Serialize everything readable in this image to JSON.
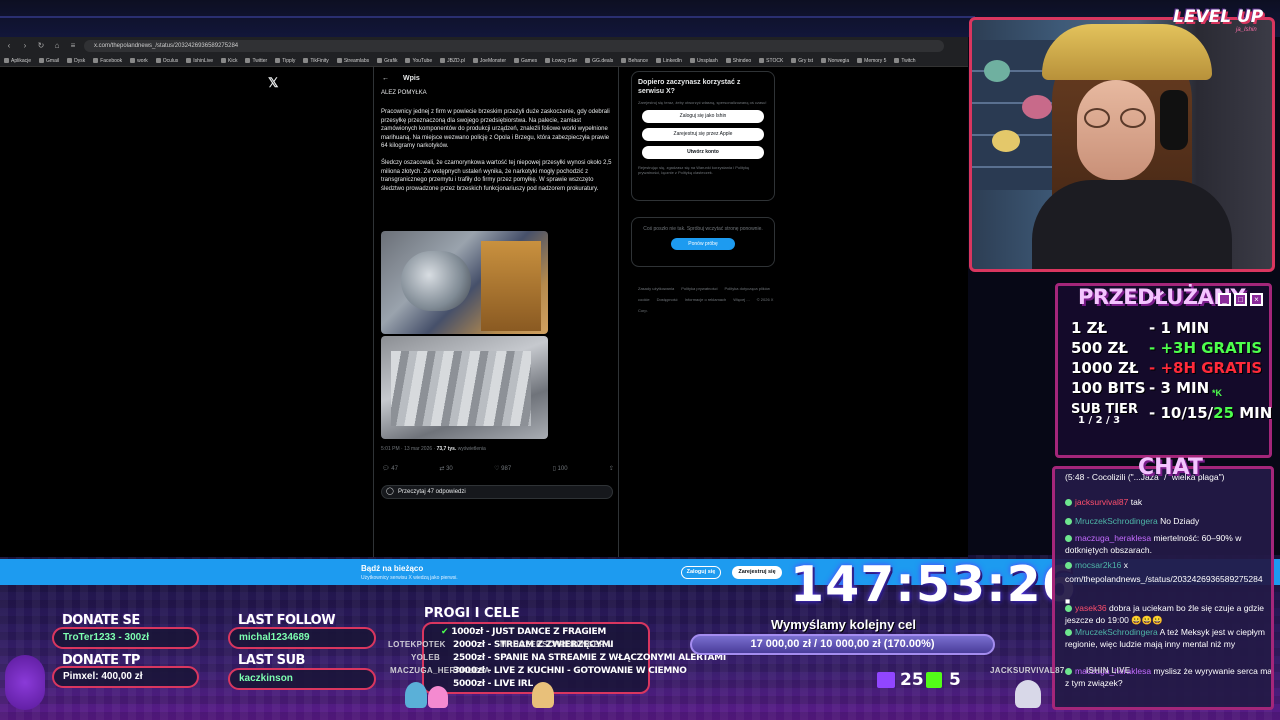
{
  "browser": {
    "url": "x.com/thepolandnews_/status/2032426936589275284",
    "bookmarks": [
      "Aplikacje",
      "Gmail",
      "Dysk",
      "Facebook",
      "work",
      "Oculus",
      "IshinLive",
      "Kick",
      "Twitter",
      "Tipply",
      "TikFinity",
      "Streamlabs",
      "Grafik",
      "YouTube",
      "JBZD.pl",
      "JoeMonster",
      "Games",
      "Łowcy Gier",
      "GG.deals",
      "Behance",
      "LinkedIn",
      "Unsplash",
      "Shindeo",
      "STOCK",
      "Gry tst",
      "Norwegia",
      "Memory 5",
      "Twitch"
    ]
  },
  "post": {
    "back": "←",
    "header": "Wpis",
    "author": "ALEZ POMYŁKA",
    "paragraph1": "Pracownicy jednej z firm w powiecie brzeskim przeżyli duże zaskoczenie, gdy odebrali przesyłkę przeznaczoną dla swojego przedsiębiorstwa. Na palecie, zamiast zamówionych komponentów do produkcji urządzeń, znaleźli foliowe worki wypełnione marihuaną. Na miejsce wezwano policję z Opola i Brzegu, która zabezpieczyła prawie 64 kilogramy narkotyków.",
    "paragraph2": "Śledczy oszacowali, że czarnorynkowa wartość tej niepowej przesyłki wynosi około 2,5 miliona złotych. Ze wstępnych ustaleń wynika, że narkotyki mogły pochodzić z transgranicznego przemytu i trafiły do firmy przez pomyłkę. W sprawie wszczęto śledztwo prowadzone przez brzeskich funkcjonariuszy pod nadzorem prokuratury.",
    "meta_time": "5:01 PM · 13 mar 2026 · ",
    "meta_views": "73,7 tys.",
    "meta_views_label": " wyświetlenia",
    "actions": [
      "47",
      "30",
      "987",
      "100",
      ""
    ],
    "replies": "Przeczytaj 47 odpowiedzi"
  },
  "signup": {
    "title": "Dopiero zaczynasz korzystać z serwisu X?",
    "subtitle": "Zarejestruj się teraz, żeby otworzyć własną, spersonalizowaną oś czasu!",
    "google": "Zaloguj się jako Ishin",
    "apple": "Zarejestruj się przez Apple",
    "create": "Utwórz konto",
    "terms": "Rejestrując się, zgadzasz się na Warunki korzystania i Politykę prywatności, łącznie z Polityką clasteczek."
  },
  "error": {
    "text": "Coś poszło nie tak. Spróbuj wczytać stronę ponownie.",
    "retry": "Ponów próbę"
  },
  "footer": [
    "Zasady użytkowania",
    "Polityka prywatności",
    "Polityka dotycząca plików cookie",
    "Dostępność",
    "Informacje o reklamach",
    "Więcej ...",
    "© 2026 X Corp."
  ],
  "banner": {
    "title": "Bądź na bieżąco",
    "subtitle": "Użytkownicy serwisu X wiedzą jako pierwsi.",
    "login": "Zaloguj się",
    "register": "Zarejestruj się"
  },
  "timer": "147:53:26",
  "brand": {
    "logo": "LEVEL UP",
    "sub": "ja_Ishin"
  },
  "prices": {
    "title": "PRZEDŁUŻANY",
    "rows": [
      {
        "k": "1 ZŁ",
        "v": "- 1 MIN"
      },
      {
        "k": "500 ZŁ",
        "v": "- +3H GRATIS"
      },
      {
        "k": "1000 ZŁ",
        "v": "- +8H GRATIS"
      },
      {
        "k": "100 BITS",
        "v": "- 3 MIN"
      },
      {
        "k": "SUB TIER",
        "v_a": "- 10/15/",
        "v_b": "25",
        "v_c": " MIN"
      }
    ],
    "tier": "1 / 2 / 3",
    "k_mark": "*K"
  },
  "chat": {
    "title": "CHAT",
    "messages": [
      {
        "user": "",
        "text": "(5:48 - Cocolizili (\"...Jaza\" / \"wielka plaga\")"
      },
      {
        "user": "jacksurvival87",
        "text": "tak"
      },
      {
        "user": "MruczekSchrodingera",
        "text": "No Dziady"
      },
      {
        "user": "maczuga_heraklesa",
        "text": "miertelność: 60–90% w dotkniętych obszarach."
      },
      {
        "user": "mocsar2k16",
        "text": "x"
      },
      {
        "user": "",
        "text": "com/thepolandnews_/status/2032426936589275284"
      },
      {
        "user": "",
        "text": "■"
      },
      {
        "user": "yasek36",
        "text": "dobra ja uciekam bo źle się czuje a gdzie jeszcze do 19:00 😀😀😀"
      },
      {
        "user": "MruczekSchrodingera",
        "text": "A też Meksyk jest w ciepłym regionie, więc ludzie mają inny mental niż my"
      },
      {
        "user": "maczuga_heraklesa",
        "text": "myslisz że wyrywanie serca ma z tym związek?"
      }
    ]
  },
  "widgets": {
    "donate_se_label": "DONATE SE",
    "donate_se_value": "TroTer1233 - 300zł",
    "donate_tp_label": "DONATE TP",
    "donate_tp_value": "Pimxel: 400,00 zł",
    "last_follow_label": "LAST FOLLOW",
    "last_follow_value": "michal1234689",
    "last_sub_label": "LAST SUB",
    "last_sub_value": "kaczkinson",
    "progi_title": "PROGI I CELE",
    "progi": [
      "1000zł - JUST DANCE Z FRAGIEM",
      "2000zł - STREAM Z ZWIERZĘCYMI",
      "2500zł - SPANIE NA STREAMIE Z WŁĄCZONYMI ALERTAMI",
      "3000zł - LIVE Z KUCHNI - GOTOWANIE W CIEMNO",
      "5000zł - LIVE IRL"
    ],
    "ghost_names": [
      "LOTEKPOTEK",
      "YOLEB",
      "MACZUGA_HERAKLESA",
      "MRUCZEKSCHRODINGERA",
      "JACKSURVIVAL87",
      "ISHIN LIVE"
    ],
    "goal_title": "Wymyślamy kolejny cel",
    "goal_text": "17 000,00 zł  /  10 000,00 zł (170.00%)",
    "goal_progress": 1.0,
    "twitch_viewers": "25",
    "kick_viewers": "5"
  },
  "colors": {
    "accent": "#d9365f",
    "x_blue": "#1d9bf0",
    "panel_purple": "#a4267a"
  }
}
